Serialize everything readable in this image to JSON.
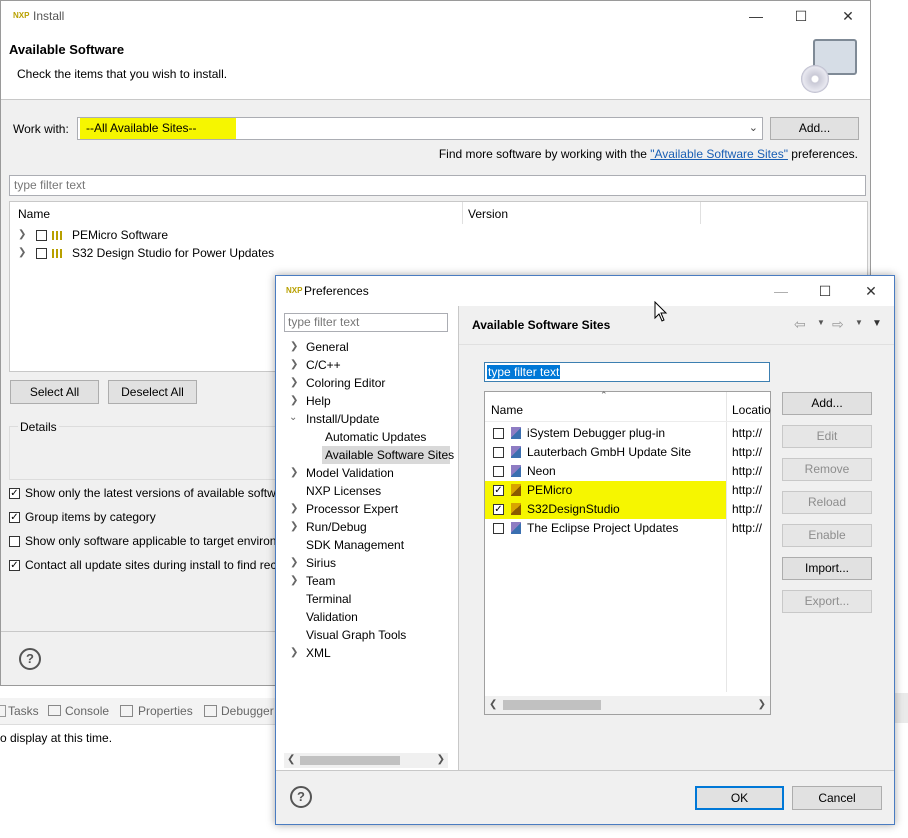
{
  "install": {
    "title": "Install",
    "heading": "Available Software",
    "subheading": "Check the items that you wish to install.",
    "work_with_label": "Work with:",
    "work_with_value": "--All Available Sites--",
    "add_label": "Add...",
    "find_more_prefix": "Find more software by working with the ",
    "find_more_link": "\"Available Software Sites\"",
    "find_more_suffix": " preferences.",
    "filter_placeholder": "type filter text",
    "columns": [
      "Name",
      "Version"
    ],
    "items": [
      "PEMicro Software",
      "S32 Design Studio for Power Updates"
    ],
    "select_all": "Select All",
    "deselect_all": "Deselect All",
    "details_label": "Details",
    "options": [
      {
        "label": "Show only the latest versions of available softwa",
        "checked": true
      },
      {
        "label": "Group items by category",
        "checked": true
      },
      {
        "label": "Show only software applicable to target environ",
        "checked": false
      },
      {
        "label": "Contact all update sites during install to find rec",
        "checked": true
      }
    ],
    "help_icon": "?"
  },
  "background": {
    "tabs": [
      "Tasks",
      "Console",
      "Properties",
      "Debugger"
    ],
    "status": "o display at this time."
  },
  "prefs": {
    "title": "Preferences",
    "filter_placeholder": "type filter text",
    "tree": [
      {
        "label": "General",
        "expandable": true,
        "indent": 0
      },
      {
        "label": "C/C++",
        "expandable": true,
        "indent": 0
      },
      {
        "label": "Coloring Editor",
        "expandable": true,
        "indent": 0
      },
      {
        "label": "Help",
        "expandable": true,
        "indent": 0
      },
      {
        "label": "Install/Update",
        "expandable": true,
        "expanded": true,
        "indent": 0
      },
      {
        "label": "Automatic Updates",
        "expandable": false,
        "indent": 1
      },
      {
        "label": "Available Software Sites",
        "expandable": false,
        "indent": 1,
        "selected": true
      },
      {
        "label": "Model Validation",
        "expandable": true,
        "indent": 0
      },
      {
        "label": "NXP Licenses",
        "expandable": false,
        "indent": 0
      },
      {
        "label": "Processor Expert",
        "expandable": true,
        "indent": 0
      },
      {
        "label": "Run/Debug",
        "expandable": true,
        "indent": 0
      },
      {
        "label": "SDK Management",
        "expandable": false,
        "indent": 0
      },
      {
        "label": "Sirius",
        "expandable": true,
        "indent": 0
      },
      {
        "label": "Team",
        "expandable": true,
        "indent": 0
      },
      {
        "label": "Terminal",
        "expandable": false,
        "indent": 0
      },
      {
        "label": "Validation",
        "expandable": false,
        "indent": 0
      },
      {
        "label": "Visual Graph Tools",
        "expandable": false,
        "indent": 0
      },
      {
        "label": "XML",
        "expandable": true,
        "indent": 0
      }
    ],
    "page_title": "Available Software Sites",
    "sites_filter_value": "type filter text",
    "site_columns": [
      "Name",
      "Locatio"
    ],
    "sites": [
      {
        "name": "iSystem Debugger plug-in",
        "location": "http://",
        "checked": false,
        "highlight": false
      },
      {
        "name": "Lauterbach GmbH Update Site",
        "location": "http://",
        "checked": false,
        "highlight": false
      },
      {
        "name": "Neon",
        "location": "http://",
        "checked": false,
        "highlight": false
      },
      {
        "name": "PEMicro",
        "location": "http://",
        "checked": true,
        "highlight": true
      },
      {
        "name": "S32DesignStudio",
        "location": "http://",
        "checked": true,
        "highlight": true
      },
      {
        "name": "The Eclipse Project Updates",
        "location": "http://",
        "checked": false,
        "highlight": false
      }
    ],
    "buttons": [
      {
        "label": "Add...",
        "enabled": true
      },
      {
        "label": "Edit",
        "enabled": false
      },
      {
        "label": "Remove",
        "enabled": false
      },
      {
        "label": "Reload",
        "enabled": false
      },
      {
        "label": "Enable",
        "enabled": false
      },
      {
        "label": "Import...",
        "enabled": true
      },
      {
        "label": "Export...",
        "enabled": false
      }
    ],
    "ok_label": "OK",
    "cancel_label": "Cancel",
    "help_icon": "?"
  },
  "colors": {
    "highlight": "#f6f600",
    "link": "#1a5fb4",
    "selection": "#0078d7"
  }
}
